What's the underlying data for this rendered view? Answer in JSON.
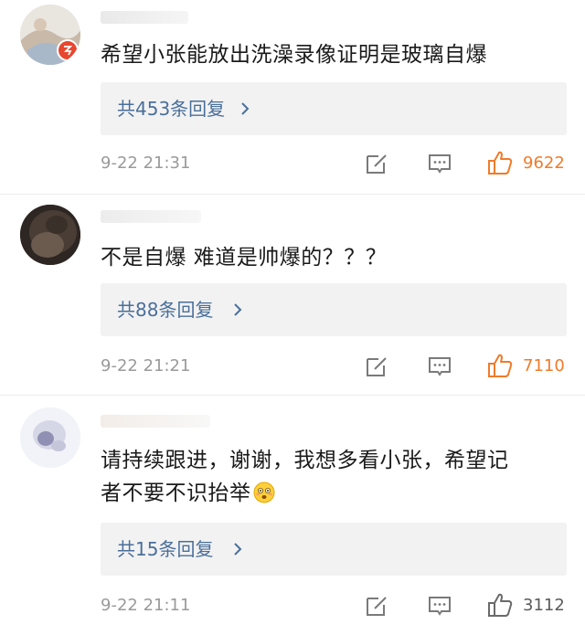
{
  "colors": {
    "reply_link": "#4a6f9a",
    "like_active": "#f07b2a",
    "like_inactive": "#6a6a6a",
    "icon_gray": "#7a7a7a",
    "reply_bg": "#f2f2f2"
  },
  "comments": [
    {
      "text": "希望小张能放出洗澡录像证明是玻璃自爆",
      "replies_label": "共453条回复",
      "time": "9-22 21:31",
      "likes": "9622",
      "liked": true
    },
    {
      "text": "不是自爆 难道是帅爆的？？？",
      "replies_label": "共88条回复",
      "time": "9-22 21:21",
      "likes": "7110",
      "liked": true
    },
    {
      "text_line1": "请持续跟进，谢谢，我想多看小张，希望记",
      "text_line2": "者不要不识抬举",
      "emoji": "flushed-face-icon",
      "replies_label": "共15条回复",
      "time": "9-22 21:11",
      "likes": "3112",
      "liked": false
    }
  ]
}
